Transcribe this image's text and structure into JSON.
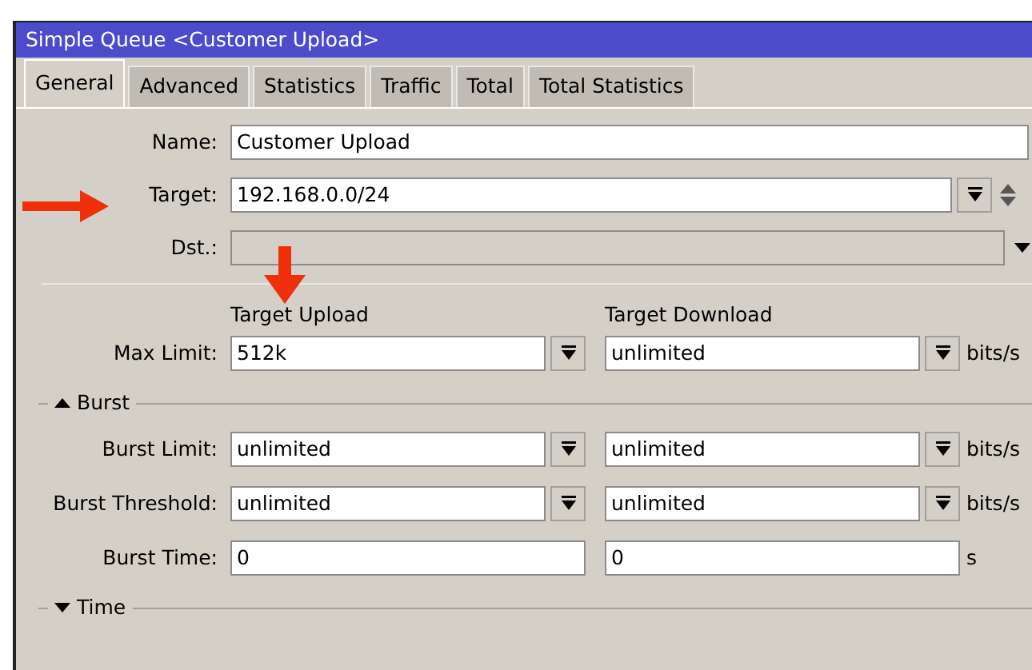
{
  "window": {
    "title": "Simple Queue <Customer Upload>"
  },
  "tabs": [
    {
      "label": "General",
      "selected": true
    },
    {
      "label": "Advanced",
      "selected": false
    },
    {
      "label": "Statistics",
      "selected": false
    },
    {
      "label": "Traffic",
      "selected": false
    },
    {
      "label": "Total",
      "selected": false
    },
    {
      "label": "Total Statistics",
      "selected": false
    }
  ],
  "fields": [
    {
      "label": "Name:",
      "value": "Customer Upload",
      "kind": "text"
    },
    {
      "label": "Target:",
      "value": "192.168.0.0/24",
      "kind": "multi"
    },
    {
      "label": "Dst.:",
      "kind": "disabled"
    }
  ],
  "columns": [
    "Target Upload",
    "Target Download"
  ],
  "max_limit": {
    "label": "Max Limit:",
    "values": [
      "512k",
      "unlimited"
    ],
    "unit": "bits/s",
    "kind": "dropdown"
  },
  "sections": [
    {
      "title": "Burst",
      "expanded": true,
      "rows": [
        {
          "label": "Burst Limit:",
          "values": [
            "unlimited",
            "unlimited"
          ],
          "unit": "bits/s",
          "kind": "dropdown"
        },
        {
          "label": "Burst Threshold:",
          "values": [
            "unlimited",
            "unlimited"
          ],
          "unit": "bits/s",
          "kind": "dropdown"
        },
        {
          "label": "Burst Time:",
          "values": [
            "0",
            "0"
          ],
          "unit": "s",
          "kind": "text"
        }
      ]
    },
    {
      "title": "Time",
      "expanded": false
    }
  ]
}
